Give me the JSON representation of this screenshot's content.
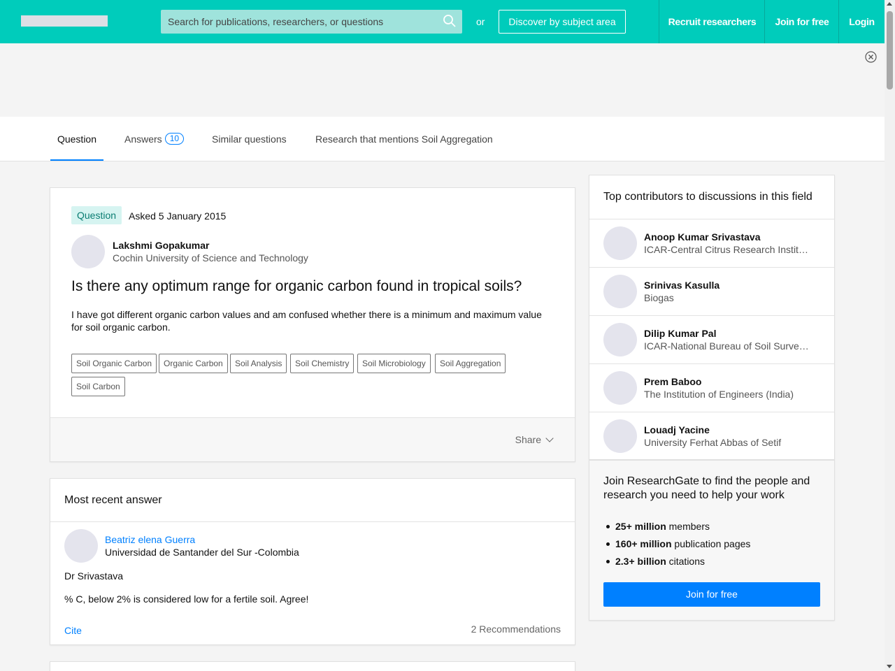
{
  "header": {
    "search_placeholder": "Search for publications, researchers, or questions",
    "or_text": "or",
    "discover_label": "Discover by subject area",
    "recruit_label": "Recruit researchers",
    "join_label": "Join for free",
    "login_label": "Login",
    "brand_color": "#00ccbb"
  },
  "tabs": {
    "question": "Question",
    "answers": "Answers",
    "answers_count": "10",
    "similar": "Similar questions",
    "research": "Research that mentions Soil Aggregation"
  },
  "question": {
    "badge": "Question",
    "asked": "Asked 5 January 2015",
    "author_name": "Lakshmi Gopakumar",
    "author_institution": "Cochin University of Science and Technology",
    "title": "Is there any optimum range for organic carbon found in tropical soils?",
    "body": "I have got different organic carbon values and am confused whether there is a minimum and maximum value for soil organic carbon.",
    "tags": [
      "Soil Organic Carbon",
      "Organic Carbon",
      "Soil Analysis",
      "Soil Chemistry",
      "Soil Microbiology",
      "Soil Aggregation",
      "Soil Carbon"
    ],
    "share_label": "Share"
  },
  "recent_answer": {
    "heading": "Most recent answer",
    "author_name": "Beatriz elena Guerra",
    "author_institution": "Universidad de Santander del Sur -Colombia",
    "line1": "Dr Srivastava",
    "line2": "% C, below 2% is considered low for a fertile soil. Agree!",
    "cite_label": "Cite",
    "recommendations": "2 Recommendations"
  },
  "contributors": {
    "title": "Top contributors to discussions in this field",
    "items": [
      {
        "name": "Anoop Kumar Srivastava",
        "institution": "ICAR-Central Citrus Research Institute"
      },
      {
        "name": "Srinivas Kasulla",
        "institution": "Biogas"
      },
      {
        "name": "Dilip Kumar Pal",
        "institution": "ICAR-National Bureau of Soil Survey and Land Use Planning"
      },
      {
        "name": "Prem Baboo",
        "institution": "The Institution of Engineers (India)"
      },
      {
        "name": "Louadj Yacine",
        "institution": "University Ferhat Abbas of Setif"
      }
    ]
  },
  "join_panel": {
    "title": "Join ResearchGate to find the people and research you need to help your work",
    "stats": [
      {
        "bold": "25+ million",
        "rest": " members"
      },
      {
        "bold": "160+ million",
        "rest": " publication pages"
      },
      {
        "bold": "2.3+ billion",
        "rest": " citations"
      }
    ],
    "button_label": "Join for free"
  }
}
